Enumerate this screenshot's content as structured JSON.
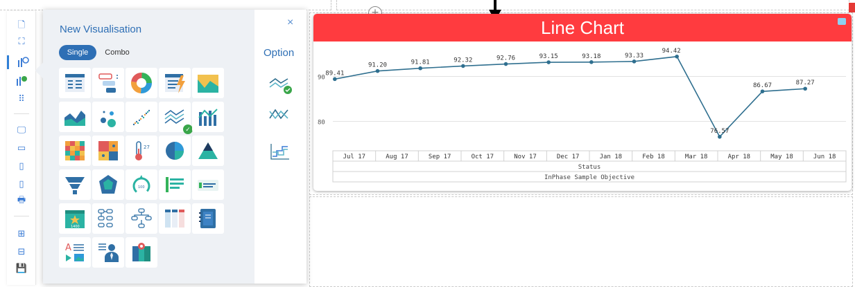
{
  "panel": {
    "title": "New Visualisation",
    "mode_tabs": [
      "Single",
      "Combo"
    ],
    "active_mode": "Single",
    "close_icon": "×",
    "option_label": "Option",
    "tiles": [
      {
        "name": "table-vis"
      },
      {
        "name": "filter-list-vis"
      },
      {
        "name": "donut-vis"
      },
      {
        "name": "kpi-table-vis"
      },
      {
        "name": "area-mountain-vis"
      },
      {
        "name": "area-vis"
      },
      {
        "name": "bubble-vis"
      },
      {
        "name": "scatter-vis"
      },
      {
        "name": "line-vis",
        "selected": true
      },
      {
        "name": "bar-line-combo-vis"
      },
      {
        "name": "heatmap-vis"
      },
      {
        "name": "treemap-vis"
      },
      {
        "name": "thermometer-vis",
        "label": "27"
      },
      {
        "name": "pie-vis"
      },
      {
        "name": "pyramid-vis"
      },
      {
        "name": "funnel-vis"
      },
      {
        "name": "radar-vis"
      },
      {
        "name": "gauge-vis",
        "label": "100"
      },
      {
        "name": "kpi-bar-vis"
      },
      {
        "name": "kpi-target-vis"
      },
      {
        "name": "scorecard-vis",
        "label": "1400"
      },
      {
        "name": "org-chart-vis"
      },
      {
        "name": "tree-vis"
      },
      {
        "name": "column-table-vis"
      },
      {
        "name": "notebook-vis"
      },
      {
        "name": "text-image-vis"
      },
      {
        "name": "person-profile-vis"
      },
      {
        "name": "map-vis"
      }
    ],
    "options": [
      "line-option-a",
      "line-option-b",
      "step-option"
    ]
  },
  "widget": {
    "title": "Line Chart",
    "table_rows": [
      "Status",
      "InPhase Sample Objective"
    ]
  },
  "chart_data": {
    "type": "line",
    "categories": [
      "Jul 17",
      "Aug 17",
      "Sep 17",
      "Oct 17",
      "Nov 17",
      "Dec 17",
      "Jan 18",
      "Feb 18",
      "Mar 18",
      "Apr 18",
      "May 18",
      "Jun 18"
    ],
    "values": [
      89.41,
      91.2,
      91.81,
      92.32,
      92.76,
      93.15,
      93.18,
      93.33,
      94.42,
      76.57,
      86.67,
      87.27
    ],
    "value_labels": [
      "89.41",
      "91.20",
      "91.81",
      "92.32",
      "92.76",
      "93.15",
      "93.18",
      "93.33",
      "94.42",
      "76.57",
      "86.67",
      "87.27"
    ],
    "yticks": [
      80,
      90
    ],
    "ylim": [
      75,
      95
    ],
    "color": "#2f6f8f"
  }
}
